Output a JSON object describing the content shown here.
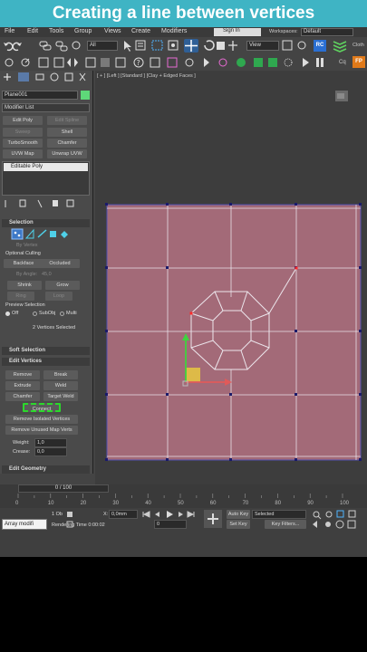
{
  "banner": {
    "title": "Creating a line between vertices"
  },
  "menubar": {
    "items": [
      "File",
      "Edit",
      "Tools",
      "Group",
      "Views",
      "Create",
      "Modifiers"
    ],
    "sign_in": "Sign In",
    "workspaces_label": "Workspaces:",
    "workspace": "Default"
  },
  "toolbar": {
    "filter_select": "All",
    "view_select": "View",
    "rc_label": "RC",
    "cloth_label": "Cloth",
    "cq_label": "Cq",
    "fp_label": "FP"
  },
  "command_panel": {
    "object_name": "Plane001",
    "modifier_list": "Modifier List",
    "modifier_buttons": [
      "Edit Poly",
      "Edit Spline",
      "Sweep",
      "Shell",
      "TurboSmooth",
      "Chamfer",
      "UVW Map",
      "Unwrap UVW"
    ],
    "stack_item": "Editable Poly",
    "selection": {
      "title": "Selection",
      "by_vertex": "By Vertex",
      "optional_culling": "Optional Culling",
      "backface": "Backface",
      "occluded": "Occluded",
      "by_angle": "By Angle:",
      "angle_value": "45,0",
      "shrink": "Shrink",
      "grow": "Grow",
      "ring": "Ring",
      "loop": "Loop",
      "preview_selection": "Preview Selection",
      "off": "Off",
      "subobj": "SubObj",
      "multi": "Multi",
      "status": "2 Vertices Selected"
    },
    "soft_selection": "Soft Selection",
    "edit_vertices": {
      "title": "Edit Vertices",
      "remove": "Remove",
      "break": "Break",
      "extrude": "Extrude",
      "weld": "Weld",
      "chamfer": "Chamfer",
      "target_weld": "Target Weld",
      "connect": "Connect",
      "remove_isolated": "Remove Isolated Vertices",
      "remove_unused": "Remove Unused Map Verts",
      "weight_label": "Weight:",
      "weight_value": "1,0",
      "crease_label": "Crease:",
      "crease_value": "0,0"
    },
    "edit_geometry": "Edit Geometry"
  },
  "viewport": {
    "label": "[ + ] [Left ] [Standard ] [Clay + Edged Faces ]"
  },
  "timeline": {
    "frame_counter": "0 / 100",
    "ticks": [
      "0",
      "10",
      "20",
      "30",
      "40",
      "50",
      "60",
      "70",
      "80",
      "90",
      "100"
    ]
  },
  "status_bar": {
    "counter": "1 Ob",
    "x_label": "X:",
    "x_value": "0,0mm",
    "rendering_time": "Rendering Time  0:00:02",
    "array_text": "Array modifi",
    "auto_key": "Auto Key",
    "set_key": "Set Key",
    "selected": "Selected",
    "key_filters": "Key Filters...",
    "frame_value": "0"
  },
  "colors": {
    "banner_bg": "#3fb4c4",
    "plane_fill": "#a06070",
    "selected_vertex": "#ff2a2a",
    "connect_highlight": "#2bd82b"
  }
}
